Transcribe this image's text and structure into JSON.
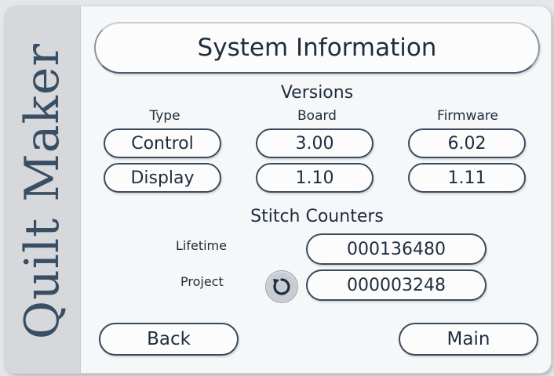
{
  "brand": "Quilt Maker",
  "title": "System Information",
  "versions": {
    "heading": "Versions",
    "col_type": "Type",
    "col_board": "Board",
    "col_firmware": "Firmware",
    "rows": [
      {
        "type": "Control",
        "board": "3.00",
        "firmware": "6.02"
      },
      {
        "type": "Display",
        "board": "1.10",
        "firmware": "1.11"
      }
    ]
  },
  "stitch": {
    "heading": "Stitch Counters",
    "lifetime_label": "Lifetime",
    "lifetime_value": "000136480",
    "project_label": "Project",
    "project_value": "000003248"
  },
  "nav": {
    "back": "Back",
    "main": "Main"
  },
  "icons": {
    "reset": "reset-counter-icon"
  }
}
